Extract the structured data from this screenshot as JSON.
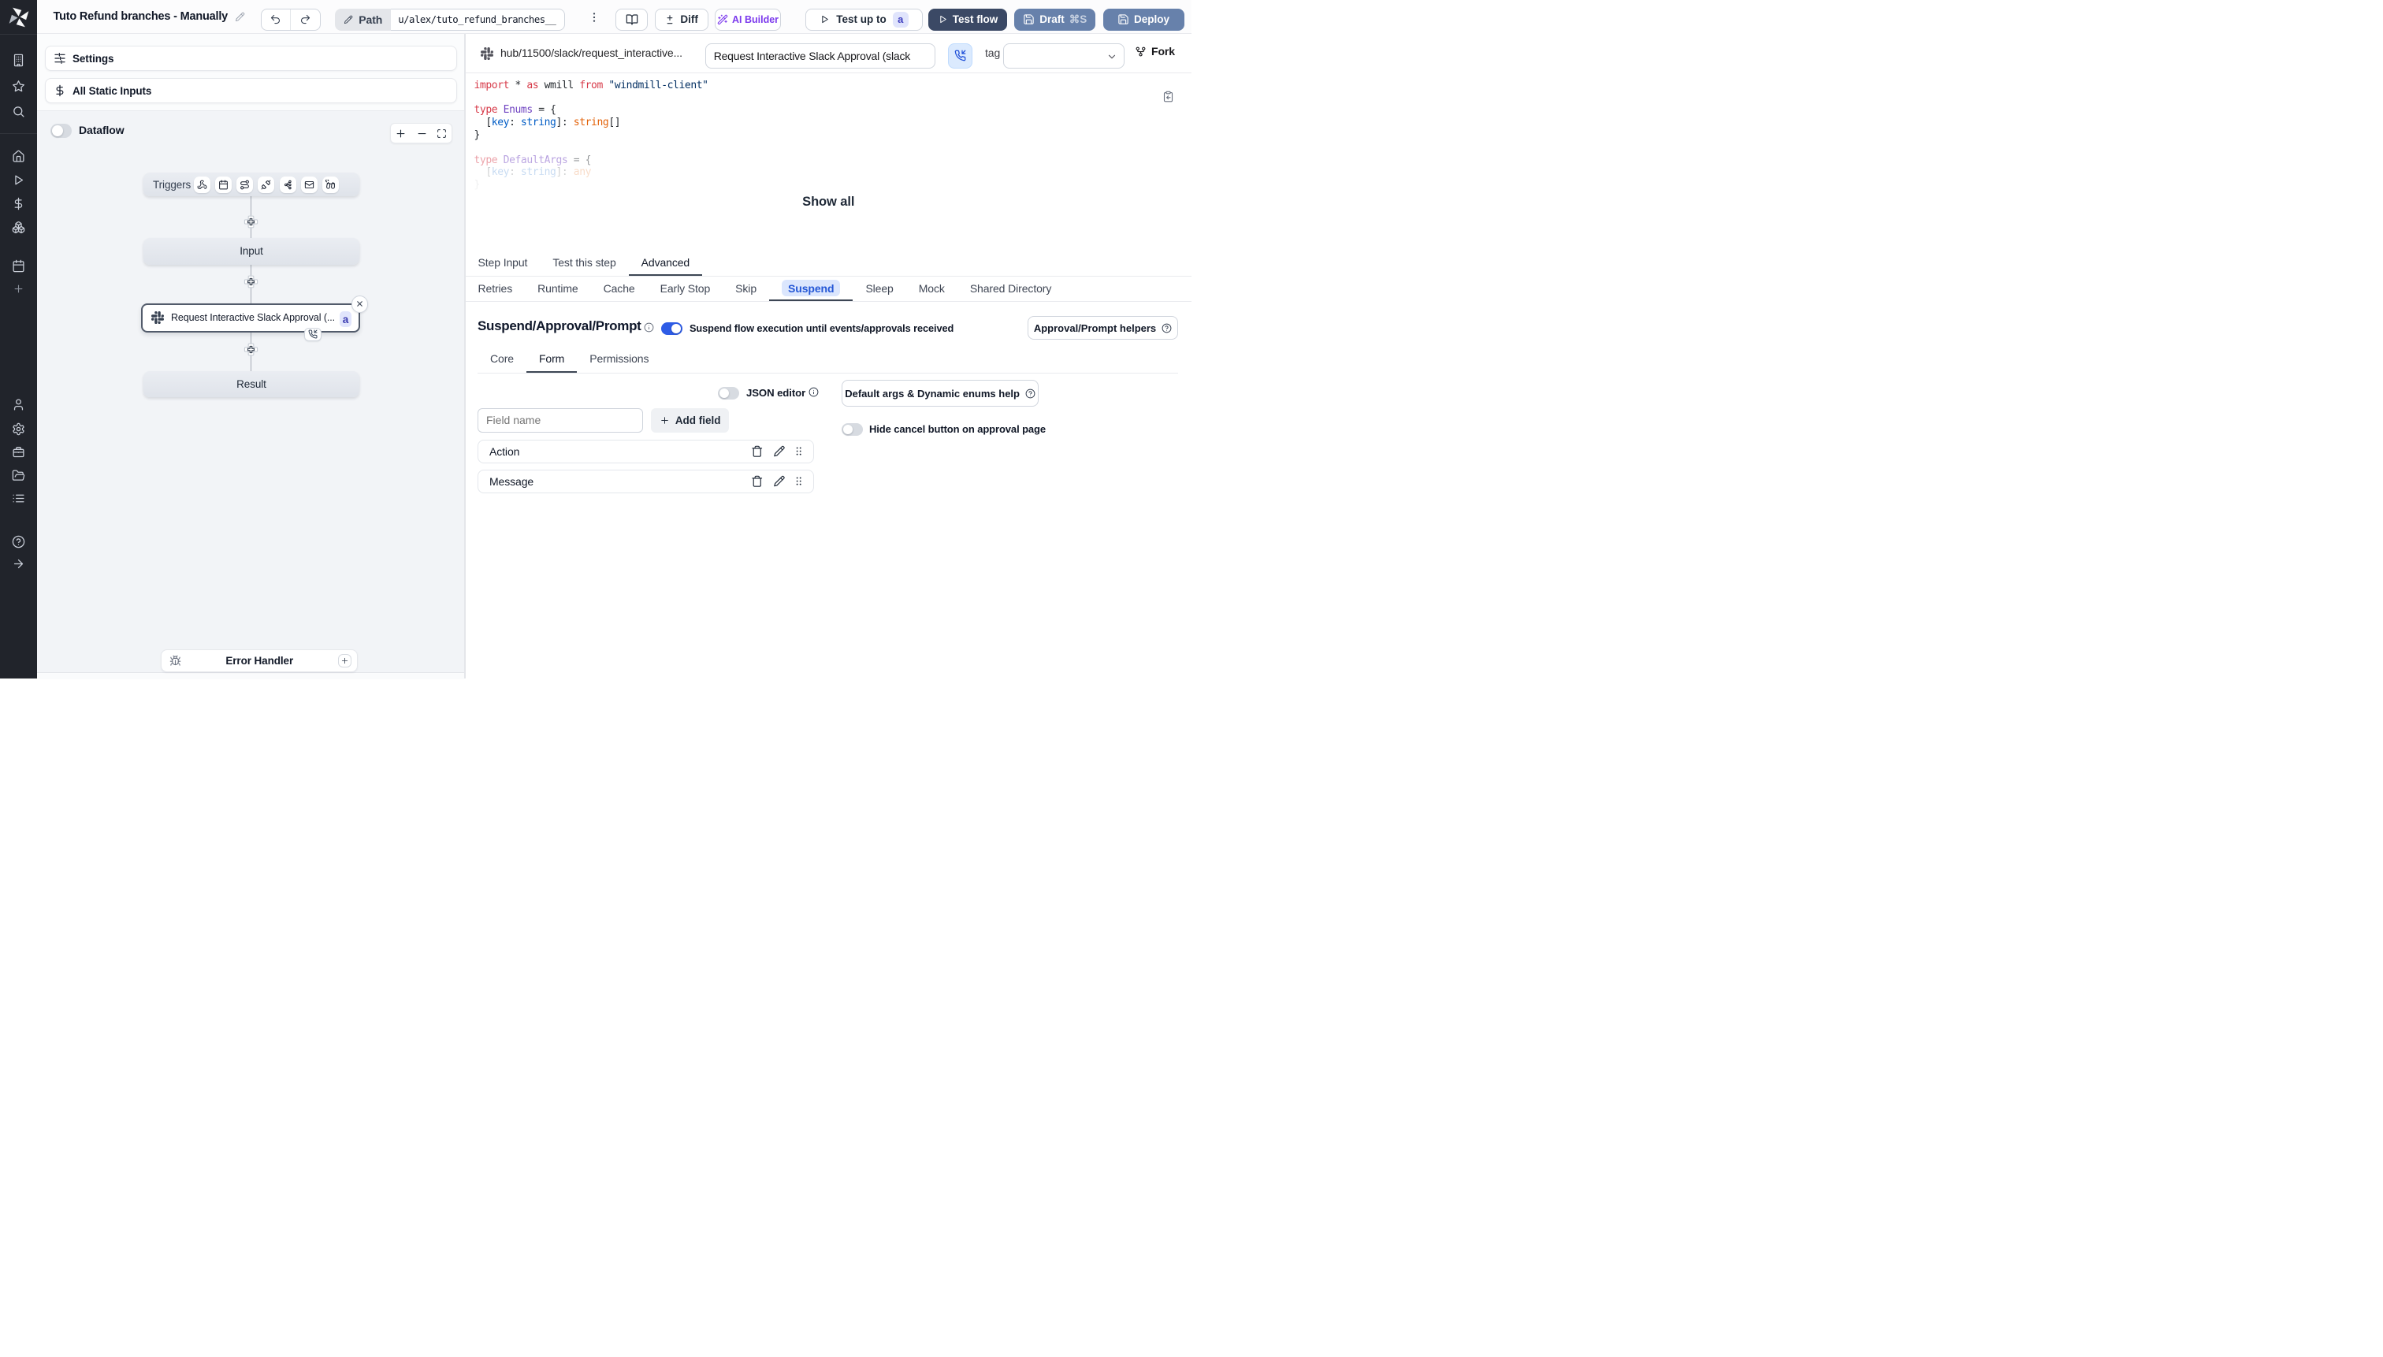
{
  "topbar": {
    "title": "Tuto Refund branches - Manually",
    "path_label": "Path",
    "path_value": "u/alex/tuto_refund_branches__",
    "diff_label": "Diff",
    "ai_builder_label": "AI Builder",
    "test_up_to_label": "Test up to",
    "test_up_to_badge": "a",
    "test_flow_label": "Test flow",
    "draft_label": "Draft",
    "draft_shortcut": "⌘S",
    "deploy_label": "Deploy"
  },
  "sidebar": {
    "top_icons": [
      "building",
      "star",
      "search"
    ],
    "main_icons": [
      "home",
      "play",
      "dollar",
      "boxes",
      "calendar",
      "plus"
    ],
    "bottom_icons": [
      "user",
      "gear",
      "toolbox",
      "folder",
      "list"
    ],
    "footer_icons": [
      "help",
      "arrow-right"
    ]
  },
  "flow_panel": {
    "settings_label": "Settings",
    "static_inputs_label": "All Static Inputs",
    "dataflow_label": "Dataflow",
    "graph": {
      "triggers_label": "Triggers",
      "trigger_icons": [
        "webhook",
        "calendar",
        "route",
        "plug",
        "kafka",
        "mail",
        "binoculars"
      ],
      "input_label": "Input",
      "step_label": "Request Interactive Slack Approval (...",
      "step_badge": "a",
      "result_label": "Result",
      "error_handler_label": "Error Handler"
    }
  },
  "step_panel": {
    "hub_path": "hub/11500/slack/request_interactive...",
    "summary_value": "Request Interactive Slack Approval (slack",
    "tag_label": "tag",
    "fork_label": "Fork",
    "show_all_label": "Show all",
    "tabs": [
      "Step Input",
      "Test this step",
      "Advanced"
    ],
    "active_tab": "Advanced",
    "subtabs": [
      "Retries",
      "Runtime",
      "Cache",
      "Early Stop",
      "Skip",
      "Suspend",
      "Sleep",
      "Mock",
      "Shared Directory"
    ],
    "active_subtab": "Suspend",
    "code_lines": [
      {
        "opacity": 1,
        "tokens": [
          [
            "kw",
            "import"
          ],
          [
            "pl",
            " * "
          ],
          [
            "kw",
            "as"
          ],
          [
            "pl",
            " wmill "
          ],
          [
            "kw",
            "from"
          ],
          [
            "pl",
            " "
          ],
          [
            "st",
            "\"windmill-client\""
          ]
        ]
      },
      {
        "opacity": 1,
        "tokens": []
      },
      {
        "opacity": 1,
        "tokens": [
          [
            "kw",
            "type"
          ],
          [
            "pl",
            " "
          ],
          [
            "ty",
            "Enums"
          ],
          [
            "pl",
            " = {"
          ]
        ]
      },
      {
        "opacity": 1,
        "tokens": [
          [
            "pl",
            "  ["
          ],
          [
            "pr",
            "key"
          ],
          [
            "pl",
            ": "
          ],
          [
            "pr",
            "string"
          ],
          [
            "pl",
            "]: "
          ],
          [
            "or",
            "string"
          ],
          [
            "pl",
            "[]"
          ]
        ]
      },
      {
        "opacity": 1,
        "tokens": [
          [
            "pl",
            "}"
          ]
        ]
      },
      {
        "opacity": 1,
        "tokens": []
      },
      {
        "opacity": 0.55,
        "tokens": [
          [
            "kw",
            "type"
          ],
          [
            "pl",
            " "
          ],
          [
            "ty",
            "DefaultArgs"
          ],
          [
            "pl",
            " = {"
          ]
        ]
      },
      {
        "opacity": 0.34,
        "tokens": [
          [
            "pl",
            "  ["
          ],
          [
            "pr",
            "key"
          ],
          [
            "pl",
            ": "
          ],
          [
            "pr",
            "string"
          ],
          [
            "pl",
            "]: "
          ],
          [
            "or",
            "any"
          ]
        ]
      },
      {
        "opacity": 0.16,
        "tokens": [
          [
            "pl",
            "}"
          ]
        ]
      }
    ],
    "suspend": {
      "title": "Suspend/Approval/Prompt",
      "toggle_caption": "Suspend flow execution until events/approvals received",
      "helpers_button": "Approval/Prompt helpers",
      "tabs": [
        "Core",
        "Form",
        "Permissions"
      ],
      "active_tab": "Form",
      "json_editor_label": "JSON editor",
      "default_args_button": "Default args & Dynamic enums help",
      "field_name_placeholder": "Field name",
      "add_field_label": "Add field",
      "hide_cancel_label": "Hide cancel button on approval page",
      "fields": [
        "Action",
        "Message"
      ]
    }
  }
}
